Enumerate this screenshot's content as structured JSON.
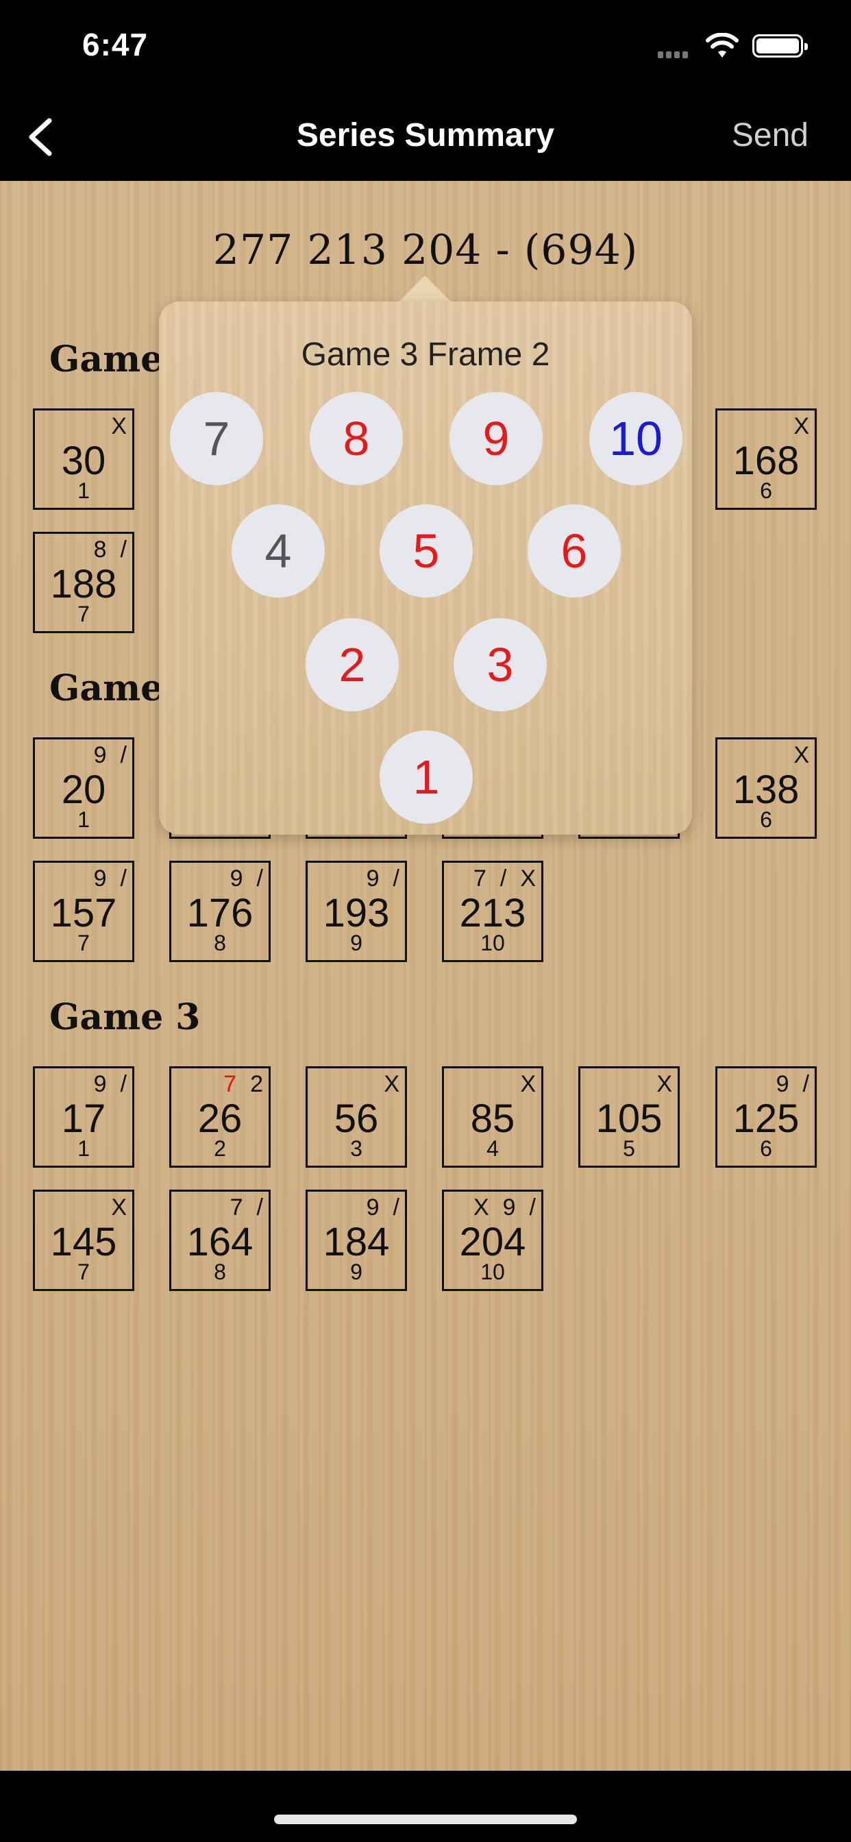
{
  "status": {
    "time": "6:47"
  },
  "nav": {
    "title": "Series Summary",
    "send": "Send"
  },
  "series": {
    "summary": "277 213 204  - (694)"
  },
  "games": [
    {
      "title": "Game I",
      "frames": [
        {
          "marks": [
            "X"
          ],
          "score": "30",
          "num": "1"
        },
        {
          "marks": [
            "X"
          ],
          "score": "168",
          "num": "6"
        },
        {
          "marks": [
            "8",
            "/"
          ],
          "score": "188",
          "num": "7"
        }
      ]
    },
    {
      "title": "Game 2",
      "frames": [
        {
          "marks": [
            "9",
            "/"
          ],
          "score": "20",
          "num": "1"
        },
        {
          "marks": [
            "X"
          ],
          "score": "138",
          "num": "6"
        },
        {
          "marks": [
            "9",
            "/"
          ],
          "score": "157",
          "num": "7"
        },
        {
          "marks": [
            "9",
            "/"
          ],
          "score": "176",
          "num": "8"
        },
        {
          "marks": [
            "9",
            "/"
          ],
          "score": "193",
          "num": "9"
        },
        {
          "marks": [
            "7",
            "/",
            "X"
          ],
          "score": "213",
          "num": "10"
        }
      ]
    },
    {
      "title": "Game 3",
      "frames": [
        {
          "marks": [
            "9",
            "/"
          ],
          "score": "17",
          "num": "1"
        },
        {
          "marks": [
            "7",
            "2"
          ],
          "score": "26",
          "num": "2"
        },
        {
          "marks": [
            "X"
          ],
          "score": "56",
          "num": "3"
        },
        {
          "marks": [
            "X"
          ],
          "score": "85",
          "num": "4"
        },
        {
          "marks": [
            "X"
          ],
          "score": "105",
          "num": "5"
        },
        {
          "marks": [
            "9",
            "/"
          ],
          "score": "125",
          "num": "6"
        },
        {
          "marks": [
            "X"
          ],
          "score": "145",
          "num": "7"
        },
        {
          "marks": [
            "7",
            "/"
          ],
          "score": "164",
          "num": "8"
        },
        {
          "marks": [
            "9",
            "/"
          ],
          "score": "184",
          "num": "9"
        },
        {
          "marks": [
            "X",
            "9",
            "/"
          ],
          "score": "204",
          "num": "10"
        }
      ]
    }
  ],
  "popover": {
    "title": "Game 3 Frame 2",
    "pins": [
      {
        "label": "7",
        "state": "standing"
      },
      {
        "label": "8",
        "state": "first-ball"
      },
      {
        "label": "9",
        "state": "first-ball"
      },
      {
        "label": "10",
        "state": "second-ball"
      },
      {
        "label": "4",
        "state": "standing"
      },
      {
        "label": "5",
        "state": "first-ball"
      },
      {
        "label": "6",
        "state": "first-ball"
      },
      {
        "label": "2",
        "state": "first-ball"
      },
      {
        "label": "3",
        "state": "first-ball"
      },
      {
        "label": "1",
        "state": "first-ball"
      }
    ]
  },
  "colors": {
    "first_ball": "#e51b1b",
    "second_ball": "#1a1ad8",
    "standing": "#555555",
    "red_mark": "#e31414"
  }
}
